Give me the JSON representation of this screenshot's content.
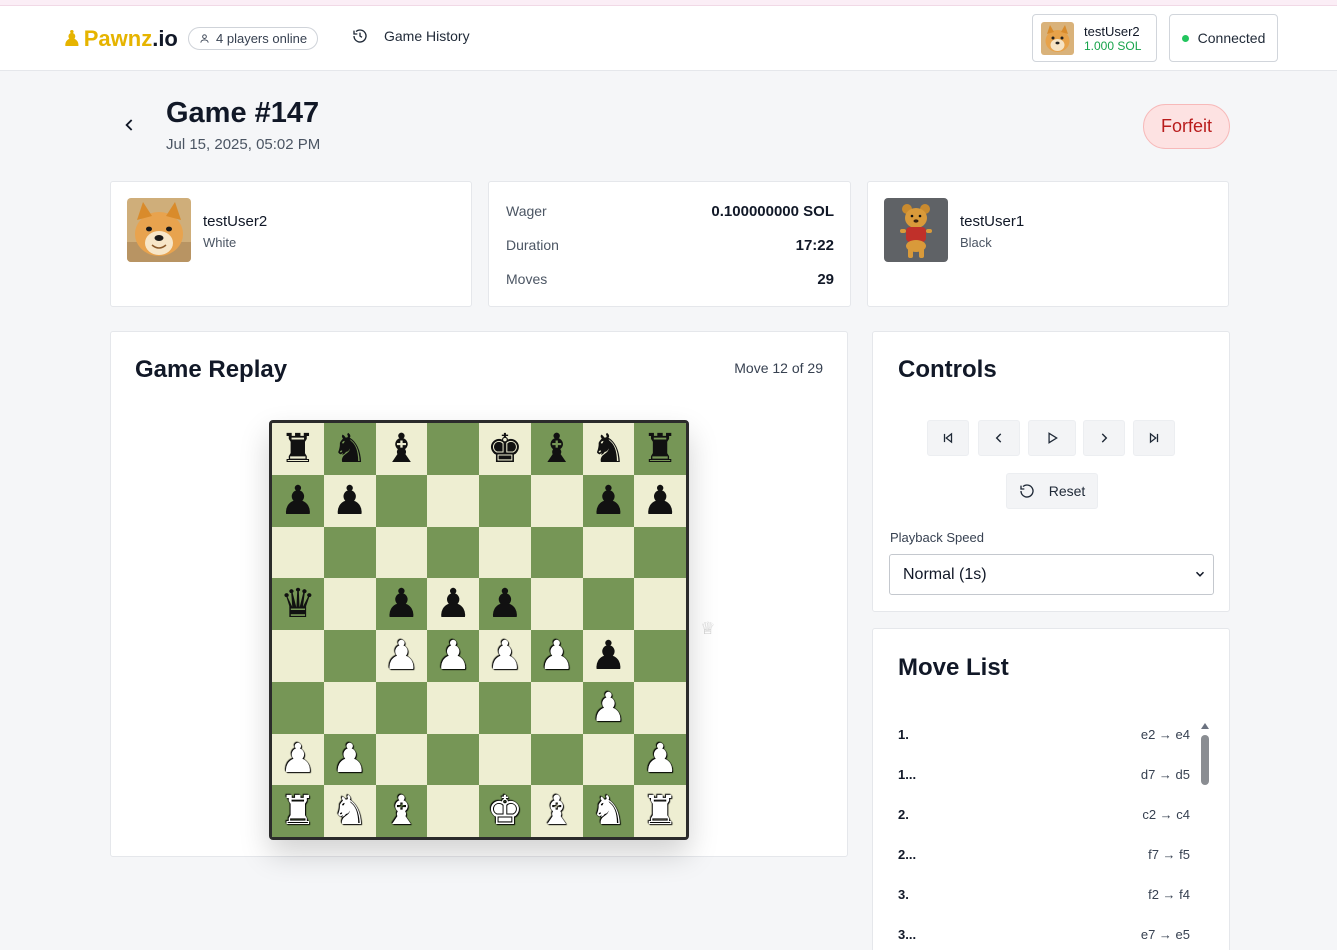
{
  "navbar": {
    "brand_name": "Pawnz",
    "brand_tld": ".io",
    "online_text": "4 players online",
    "history_label": "Game History",
    "user": {
      "name": "testUser2",
      "balance": "1.000 SOL"
    },
    "connection_status": "Connected"
  },
  "game": {
    "title": "Game #147",
    "date": "Jul 15, 2025, 05:02 PM",
    "result_badge": "Forfeit"
  },
  "players": {
    "white": {
      "name": "testUser2",
      "color": "White"
    },
    "black": {
      "name": "testUser1",
      "color": "Black"
    }
  },
  "stats": [
    {
      "label": "Wager",
      "value": "0.100000000 SOL"
    },
    {
      "label": "Duration",
      "value": "17:22"
    },
    {
      "label": "Moves",
      "value": "29"
    }
  ],
  "replay": {
    "title": "Game Replay",
    "move_counter": "Move 12 of 29",
    "board": [
      [
        "r",
        "n",
        "b",
        "",
        "k",
        "b",
        "n",
        "r"
      ],
      [
        "p",
        "p",
        "",
        "",
        "",
        "",
        "p",
        "p"
      ],
      [
        "",
        "",
        "",
        "",
        "",
        "",
        "",
        ""
      ],
      [
        "q",
        "",
        "p",
        "p",
        "p",
        "",
        "",
        ""
      ],
      [
        "",
        "",
        "P",
        "P",
        "P",
        "P",
        "p",
        ""
      ],
      [
        "",
        "",
        "",
        "",
        "",
        "",
        "P",
        ""
      ],
      [
        "P",
        "P",
        "",
        "",
        "",
        "",
        "",
        "P"
      ],
      [
        "R",
        "N",
        "B",
        "",
        "K",
        "B",
        "N",
        "R"
      ]
    ]
  },
  "controls": {
    "title": "Controls",
    "reset_label": "Reset",
    "speed_label": "Playback Speed",
    "speed_value": "Normal (1s)"
  },
  "move_list": {
    "title": "Move List",
    "moves": [
      {
        "num": "1.",
        "san": "e2 → e4"
      },
      {
        "num": "1...",
        "san": "d7 → d5"
      },
      {
        "num": "2.",
        "san": "c2 → c4"
      },
      {
        "num": "2...",
        "san": "f7 → f5"
      },
      {
        "num": "3.",
        "san": "f2 → f4"
      },
      {
        "num": "3...",
        "san": "e7 → e5"
      }
    ]
  },
  "colors": {
    "accent": "#e6b400",
    "board_light": "#eeeed2",
    "board_dark": "#769656",
    "forfeit": "#b91c1c",
    "connected": "#22c55e",
    "balance": "#16a34a"
  },
  "icons": {
    "online": "user-icon",
    "history": "history-icon",
    "back": "chevron-left-icon",
    "first": "skip-back-icon",
    "prev": "chevron-left-icon",
    "play": "play-icon",
    "next": "chevron-right-icon",
    "last": "skip-forward-icon",
    "reset": "rotate-ccw-icon"
  }
}
